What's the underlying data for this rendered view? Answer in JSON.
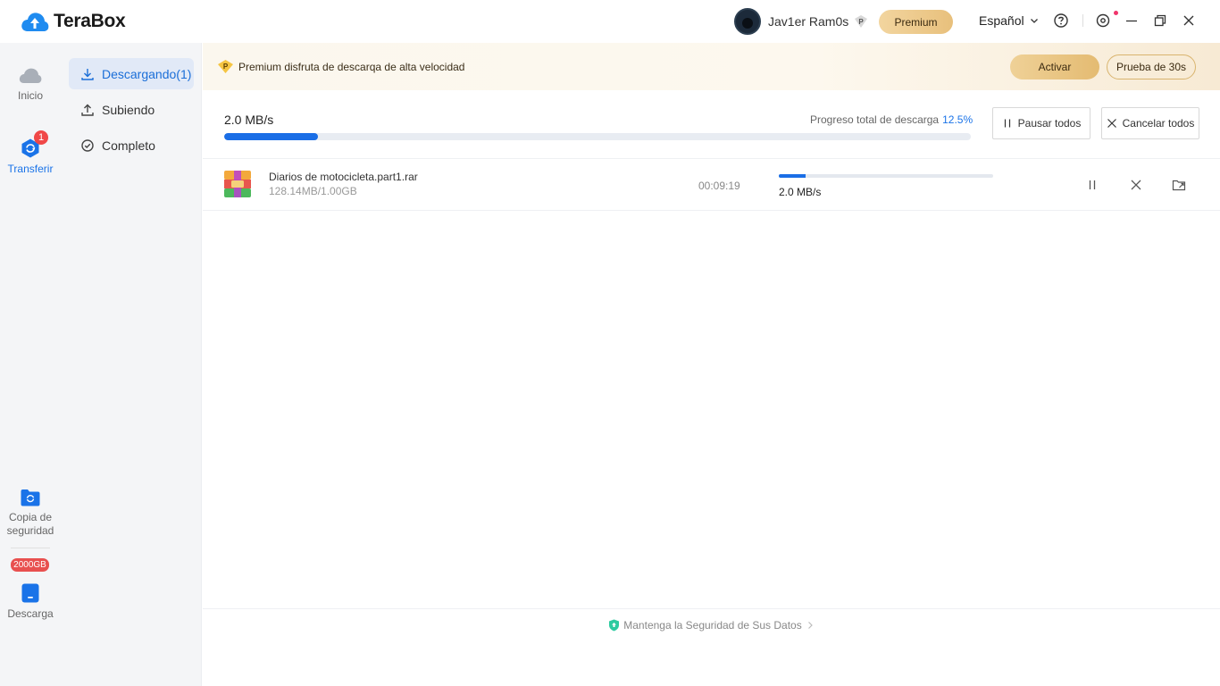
{
  "app": {
    "name": "TeraBox"
  },
  "header": {
    "username": "Jav1er Ram0s",
    "premium_label": "Premium",
    "language": "Español"
  },
  "rail": {
    "home_label": "Inicio",
    "transfer_label": "Transferir",
    "transfer_badge": "1",
    "backup_label": "Copia de seguridad",
    "storage_badge": "2000GB",
    "download_label": "Descarga"
  },
  "subnav": {
    "items": [
      {
        "label": "Descargando(1)"
      },
      {
        "label": "Subiendo"
      },
      {
        "label": "Completo"
      }
    ]
  },
  "promo": {
    "text": "Premium disfruta de descarqa de alta velocidad",
    "activate_label": "Activar",
    "trial_label": "Prueba de 30s"
  },
  "summary": {
    "speed": "2.0 MB/s",
    "progress_label": "Progreso total de descarga",
    "progress_pct": "12.5%",
    "progress_value": 0.125,
    "pause_all_label": "Pausar todos",
    "cancel_all_label": "Cancelar todos"
  },
  "downloads": [
    {
      "name": "Diarios de motocicleta.part1.rar",
      "size": "128.14MB/1.00GB",
      "eta": "00:09:19",
      "speed": "2.0 MB/s",
      "progress_value": 0.125
    }
  ],
  "footer": {
    "text": "Mantenga la Seguridad de Sus Datos"
  },
  "colors": {
    "accent": "#1a6ee6",
    "premium_gold": "#e8c07c",
    "badge_red": "#f04848"
  }
}
